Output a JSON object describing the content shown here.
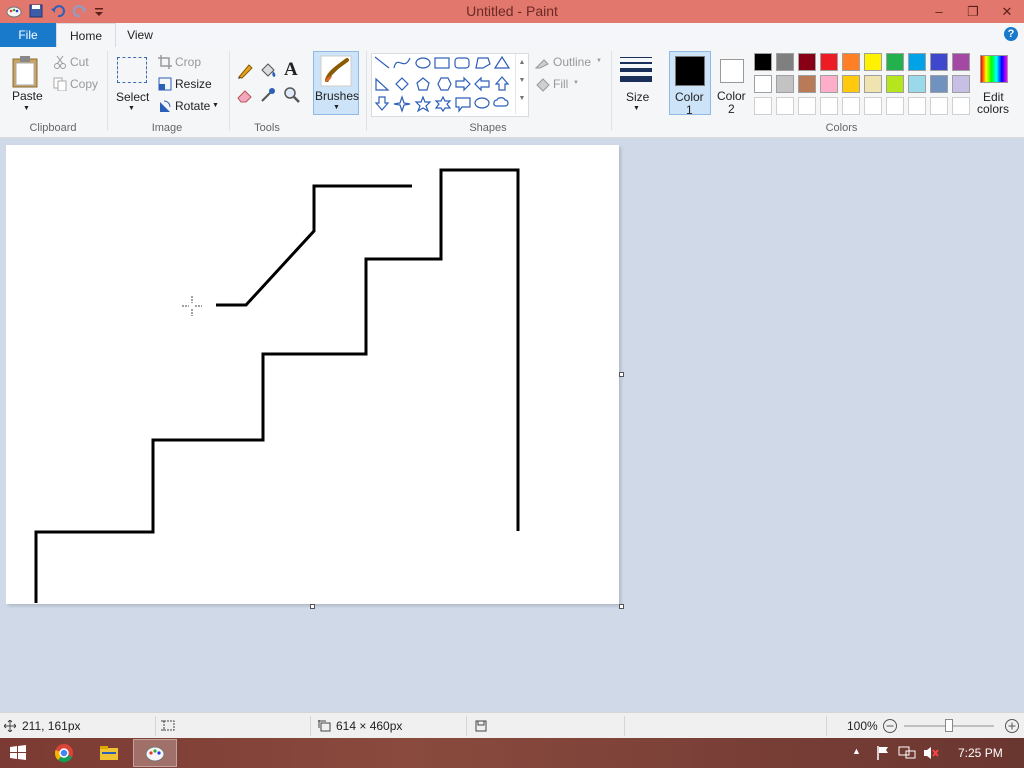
{
  "window": {
    "title": "Untitled - Paint"
  },
  "tabs": {
    "file": "File",
    "home": "Home",
    "view": "View"
  },
  "help": "?",
  "clipboard": {
    "paste": "Paste",
    "cut": "Cut",
    "copy": "Copy",
    "group": "Clipboard"
  },
  "image": {
    "select": "Select",
    "crop": "Crop",
    "resize": "Resize",
    "rotate": "Rotate",
    "group": "Image"
  },
  "tools": {
    "group": "Tools",
    "text_tool": "A"
  },
  "brushes": {
    "label": "Brushes"
  },
  "shapes": {
    "outline": "Outline",
    "fill": "Fill",
    "group": "Shapes"
  },
  "size": {
    "label": "Size"
  },
  "color1": {
    "label": "Color",
    "num": "1",
    "value": "#000000"
  },
  "color2": {
    "label": "Color",
    "num": "2",
    "value": "#ffffff"
  },
  "colors": {
    "group": "Colors",
    "edit_line1": "Edit",
    "edit_line2": "colors",
    "palette_row1": [
      "#000000",
      "#7f7f7f",
      "#880015",
      "#ed1c24",
      "#ff7f27",
      "#fff200",
      "#22b14c",
      "#00a2e8",
      "#3f48cc",
      "#a349a4"
    ],
    "palette_row2": [
      "#ffffff",
      "#c3c3c3",
      "#b97a57",
      "#ffaec9",
      "#ffc90e",
      "#efe4b0",
      "#b5e61d",
      "#99d9ea",
      "#7092be",
      "#c8bfe7"
    ]
  },
  "status": {
    "cursor_pos": "211, 161px",
    "canvas_size": "614 × 460px",
    "zoom": "100%"
  },
  "taskbar": {
    "time": "7:25 PM"
  }
}
